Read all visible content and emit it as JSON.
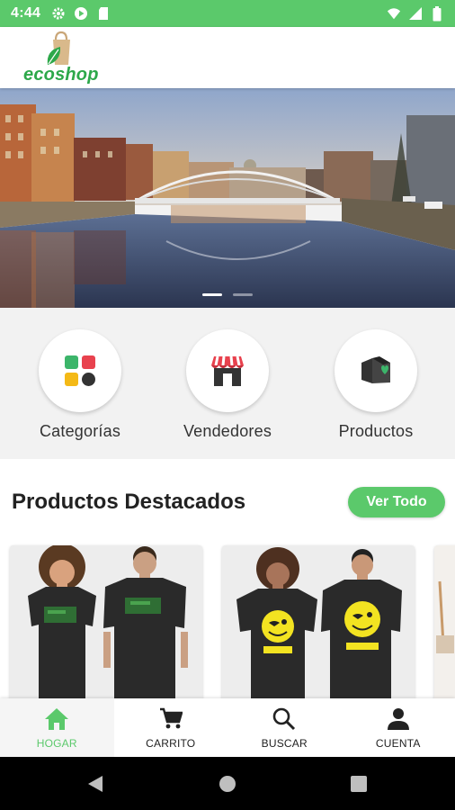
{
  "status_bar": {
    "time": "4:44",
    "icons": [
      "settings-icon",
      "play-protect-icon",
      "sd-card-icon",
      "wifi-icon",
      "signal-icon",
      "battery-icon"
    ]
  },
  "app": {
    "logo_text": "ecoshop",
    "brand_color": "#5bc96b",
    "brand_text_color": "#2da84a"
  },
  "banner": {
    "slide_count": 2,
    "active_slide": 1
  },
  "shortcuts": [
    {
      "label": "Categorías",
      "icon": "categories-icon"
    },
    {
      "label": "Vendedores",
      "icon": "store-icon"
    },
    {
      "label": "Productos",
      "icon": "product-box-icon"
    }
  ],
  "featured": {
    "title": "Productos Destacados",
    "see_all_label": "Ver Todo"
  },
  "bottom_nav": [
    {
      "label": "HOGAR",
      "icon": "home-icon",
      "active": true
    },
    {
      "label": "CARRITO",
      "icon": "cart-icon",
      "active": false
    },
    {
      "label": "BUSCAR",
      "icon": "search-icon",
      "active": false
    },
    {
      "label": "CUENTA",
      "icon": "account-icon",
      "active": false
    }
  ]
}
